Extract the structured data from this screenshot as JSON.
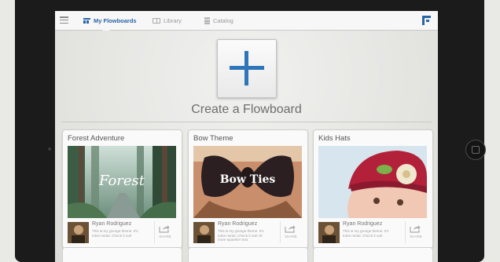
{
  "nav": {
    "tabs": [
      {
        "label": "My Flowboards",
        "icon": "flowboards-grid-icon",
        "active": true
      },
      {
        "label": "Library",
        "icon": "book-icon",
        "active": false
      },
      {
        "label": "Catalog",
        "icon": "stack-icon",
        "active": false
      }
    ]
  },
  "create": {
    "label": "Create a Flowboard"
  },
  "cards": [
    {
      "title": "Forest Adventure",
      "overlay": "Forest",
      "author": "Ryan Rodriguez",
      "description": "This is my grunge theme. It's totes metal. Check it out!",
      "share_label": "SHARE"
    },
    {
      "title": "Bow Theme",
      "overlay": "Bow Ties",
      "author": "Ryan Rodriguez",
      "description": "This is my grunge theme. It's totes metal. Check it out! Or more sparelier text.",
      "share_label": "SHARE"
    },
    {
      "title": "Kids Hats",
      "overlay": "",
      "author": "Ryan Rodriguez",
      "description": "This is my grunge theme. It's totes metal. Check it out!",
      "share_label": "SHARE"
    }
  ],
  "colors": {
    "accent": "#2a64a8",
    "plus": "#2f76b8",
    "device": "#1b1b1b"
  }
}
